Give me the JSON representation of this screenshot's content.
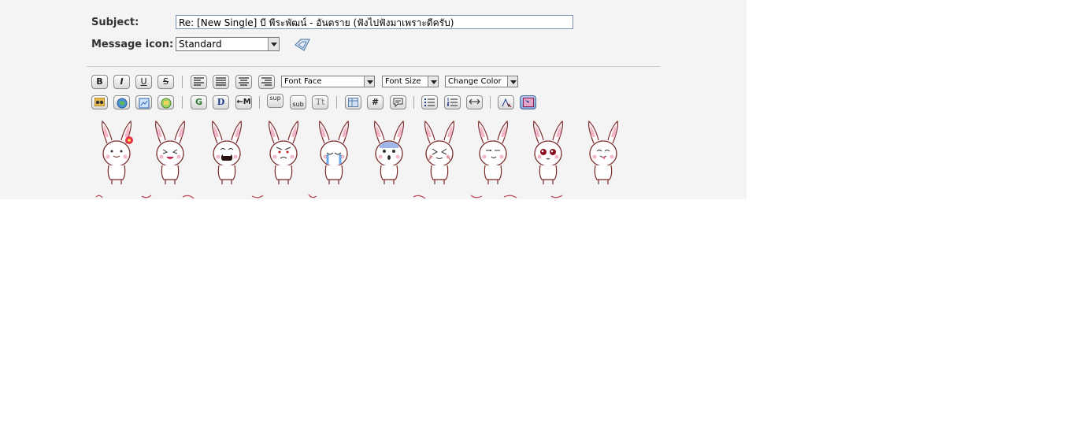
{
  "form": {
    "subject_label": "Subject:",
    "subject_value": "Re: [New Single] บี พีระพัฒน์ - อันตราย (ฟังไปฟังมาเพราะดีครับ)",
    "message_icon_label": "Message icon:",
    "message_icon_value": "Standard"
  },
  "toolbar": {
    "row1": {
      "bold": "B",
      "italic": "I",
      "underline": "U",
      "strike": "S",
      "font_face": "Font Face",
      "font_size": "Font Size",
      "change_color": "Change Color"
    },
    "row2": {
      "google": "G",
      "dictionary": "D",
      "marquee": "←M",
      "sup": "sup",
      "sub": "sub",
      "text_transform": "Tt",
      "hash": "#"
    }
  },
  "icons": [
    "bold-icon",
    "italic-icon",
    "underline-icon",
    "strike-icon",
    "align-left-icon",
    "align-justify-icon",
    "align-center-icon",
    "align-right-icon",
    "binoculars-icon",
    "globe-link-icon",
    "image-icon",
    "photo-icon",
    "table-icon",
    "quote-icon",
    "unordered-list-icon",
    "ordered-list-icon",
    "horizontal-rule-icon",
    "spell-check-icon",
    "wysiwyg-toggle-icon"
  ],
  "emoticons": [
    "bunny-flower",
    "bunny-laugh",
    "bunny-grin",
    "bunny-angry",
    "bunny-cry",
    "bunny-shocked",
    "bunny-xd",
    "bunny-smug",
    "bunny-love",
    "bunny-tongue"
  ]
}
